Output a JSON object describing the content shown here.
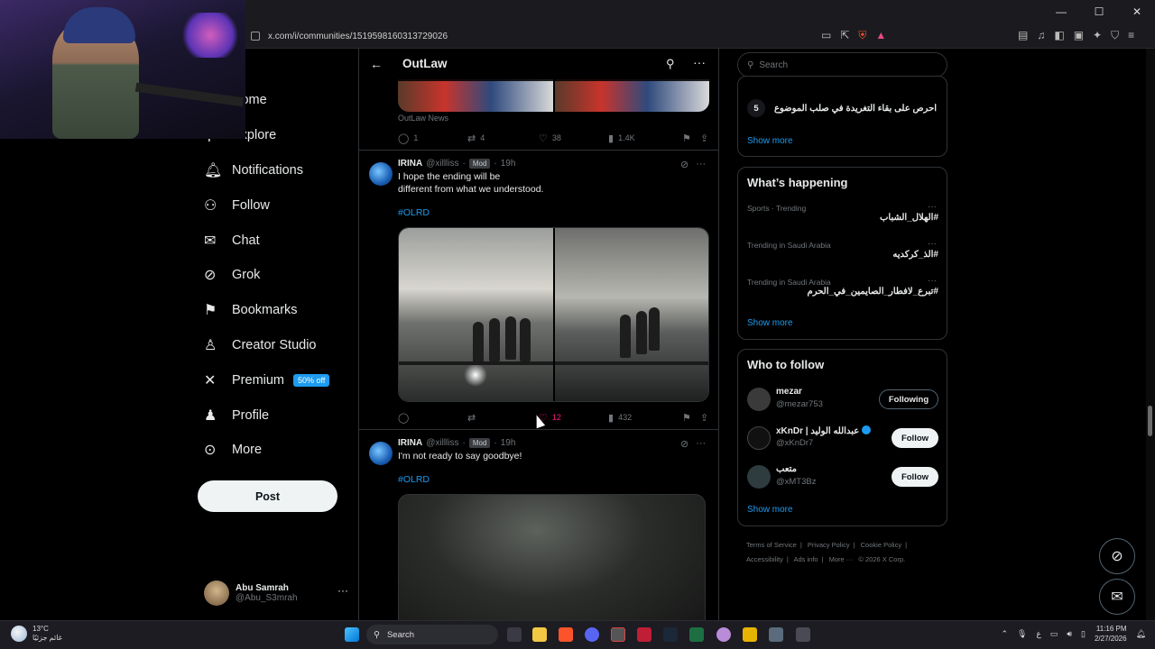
{
  "browser": {
    "url": "x.com/i/communities/1519598160313729026",
    "controls": {
      "minimize": "—",
      "maximize": "☐",
      "close": "✕"
    }
  },
  "nav": {
    "items": [
      {
        "label": "Home",
        "icon": "home-icon"
      },
      {
        "label": "Explore",
        "icon": "search-icon"
      },
      {
        "label": "Notifications",
        "icon": "bell-icon"
      },
      {
        "label": "Follow",
        "icon": "person-plus-icon"
      },
      {
        "label": "Chat",
        "icon": "mail-icon"
      },
      {
        "label": "Grok",
        "icon": "grok-icon"
      },
      {
        "label": "Bookmarks",
        "icon": "bookmark-icon"
      },
      {
        "label": "Creator Studio",
        "icon": "creator-icon"
      },
      {
        "label": "Premium",
        "icon": "x-logo-icon",
        "badge": "50% off"
      },
      {
        "label": "Profile",
        "icon": "person-icon"
      },
      {
        "label": "More",
        "icon": "more-circle-icon"
      }
    ],
    "post_label": "Post",
    "account": {
      "name": "Abu Samrah",
      "handle": "@Abu_S3mrah"
    }
  },
  "main": {
    "title": "OutLaw",
    "prev_tweet": {
      "source": "OutLaw News",
      "replies": "1",
      "reposts": "4",
      "likes": "38",
      "views": "1.4K"
    },
    "tweets": [
      {
        "name": "IRINA",
        "handle": "@xillliss",
        "role": "Mod",
        "time": "19h",
        "text": "I hope the ending will be\ndifferent from what we understood.",
        "hashtag": "#OLRD",
        "replies": "",
        "reposts": "",
        "likes": "12",
        "views": "432"
      },
      {
        "name": "IRINA",
        "handle": "@xillliss",
        "role": "Mod",
        "time": "19h",
        "text": "I'm not ready to say goodbye!",
        "hashtag": "#OLRD"
      }
    ]
  },
  "right": {
    "search_placeholder": "Search",
    "trending_top": {
      "rank": "5",
      "text": "احرص على بقاء التغريدة في صلب الموضوع",
      "show_more": "Show more"
    },
    "happening": {
      "title": "What’s happening",
      "items": [
        {
          "category": "Sports · Trending",
          "name": "#الهلال_الشباب"
        },
        {
          "category": "Trending in Saudi Arabia",
          "name": "#الذ_كركديه"
        },
        {
          "category": "Trending in Saudi Arabia",
          "name": "#تبرع_لافطار_الصايمين_في_الحرم"
        }
      ],
      "show_more": "Show more"
    },
    "who_to_follow": {
      "title": "Who to follow",
      "items": [
        {
          "name": "mezar",
          "handle": "@mezar753",
          "button": "Following"
        },
        {
          "name": "xKnDr | عبدالله الوليد",
          "handle": "@xKnDr7",
          "button": "Follow",
          "verified": true
        },
        {
          "name": "متعب",
          "handle": "@xMT3Bz",
          "button": "Follow"
        }
      ],
      "show_more": "Show more"
    },
    "footer": [
      "Terms of Service",
      "|",
      "Privacy Policy",
      "|",
      "Cookie Policy",
      "|",
      "Accessibility",
      "|",
      "Ads info",
      "|",
      "More ···",
      "© 2026 X Corp."
    ]
  },
  "taskbar": {
    "weather_temp": "13°C",
    "weather_desc": "غائم جزئيًا",
    "search": "Search",
    "time": "11:16 PM",
    "date": "2/27/2026",
    "lang": "ع"
  }
}
